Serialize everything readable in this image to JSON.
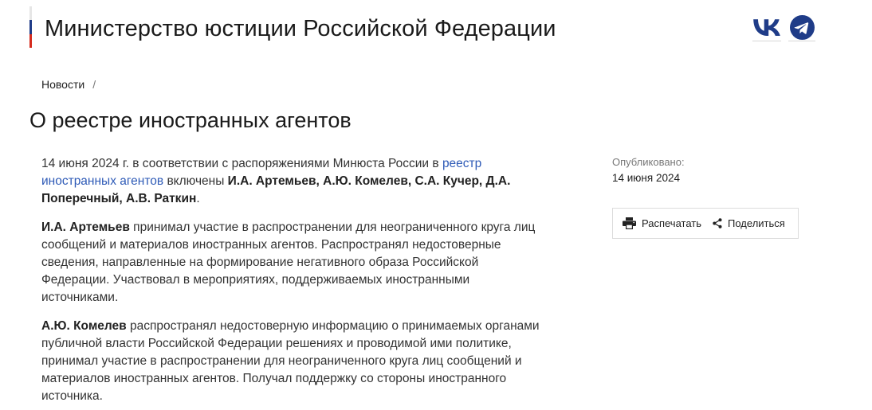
{
  "header": {
    "title": "Министерство юстиции Российской Федерации",
    "social": [
      {
        "icon": "vk-icon"
      },
      {
        "icon": "telegram-icon"
      }
    ],
    "colors": {
      "flag_white": "#e6e6e6",
      "flag_blue": "#1f3c88",
      "flag_red": "#d52b1e",
      "social_blue": "#1f3c88"
    }
  },
  "breadcrumb": {
    "items": [
      "Новости"
    ],
    "separator": "/"
  },
  "page_title": "О реестре иностранных агентов",
  "article": {
    "p1": {
      "text_before": "14 июня 2024 г. в соответствии с распоряжениями Минюста России в ",
      "link": "реестр иностранных агентов",
      "text_middle": " включены ",
      "bold_names": "И.А. Артемьев, А.Ю. Комелев, С.А. Кучер, Д.А. Поперечный, А.В. Раткин",
      "text_after": "."
    },
    "p2": {
      "bold": "И.А. Артемьев",
      "text": " принимал участие в распространении для неограниченного круга лиц сообщений и материалов иностранных агентов. Распространял недостоверные сведения, направленные на формирование негативного образа Российской Федерации. Участвовал в мероприятиях, поддерживаемых иностранными источниками."
    },
    "p3": {
      "bold": "А.Ю. Комелев",
      "text": " распространял недостоверную информацию о принимаемых органами публичной власти Российской Федерации решениях и проводимой ими политике, принимал участие в распространении для неограниченного круга лиц сообщений и материалов иностранных агентов. Получал поддержку со стороны иностранного источника."
    },
    "link_color": "#2f5bb7"
  },
  "sidebar": {
    "published_label": "Опубликовано:",
    "published_date": "14 июня 2024",
    "print_label": "Распечатать",
    "share_label": "Поделиться",
    "print_icon": "printer-icon",
    "share_icon": "share-icon"
  }
}
